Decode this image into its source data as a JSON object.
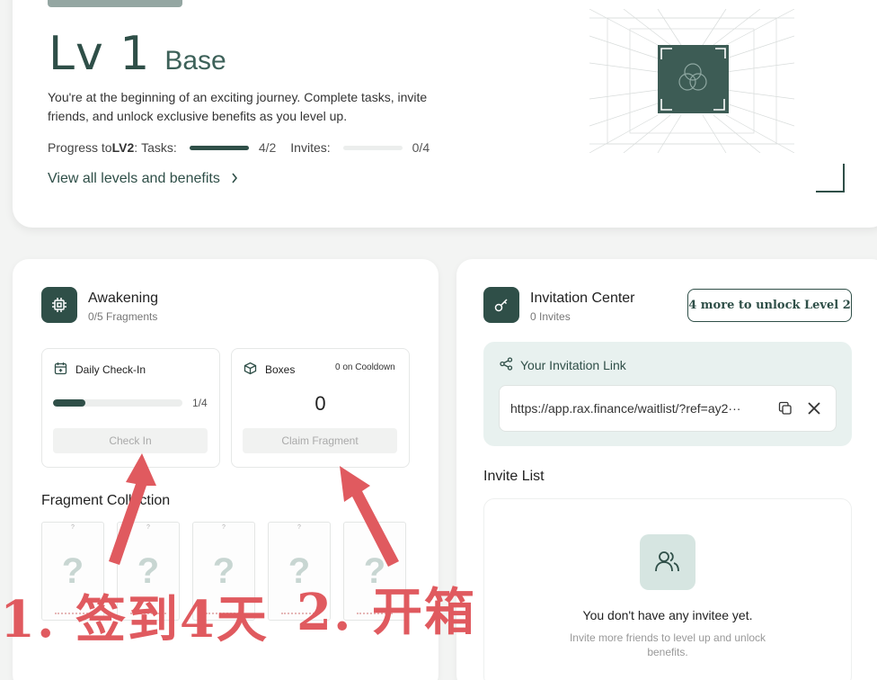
{
  "level": {
    "number": "Lv 1",
    "name": "Base",
    "description": "You're at the beginning of an exciting journey. Complete tasks, invite friends, and unlock exclusive benefits as you level up.",
    "progress_prefix": "Progress to ",
    "progress_target": "LV2",
    "progress_suffix": ":",
    "tasks_label": "Tasks:",
    "tasks_value": "4/2",
    "tasks_fraction": 1.0,
    "invites_label": "Invites:",
    "invites_value": "0/4",
    "invites_fraction": 0.0,
    "view_all_label": "View all levels and benefits"
  },
  "awakening": {
    "title": "Awakening",
    "subtitle": "0/5 Fragments",
    "checkin": {
      "title": "Daily Check-In",
      "count": "1/4",
      "fraction": 0.25,
      "button": "Check In"
    },
    "boxes": {
      "title": "Boxes",
      "cooldown": "0 on Cooldown",
      "count": "0",
      "button": "Claim Fragment"
    },
    "fragment_title": "Fragment Collection",
    "fragments": [
      "?",
      "?",
      "?",
      "?",
      "?"
    ]
  },
  "invitation": {
    "title": "Invitation Center",
    "subtitle": "0 Invites",
    "unlock_button": "4 more to unlock Level 2",
    "link_label": "Your Invitation Link",
    "link_url": "https://app.rax.finance/waitlist/?ref=ay2···",
    "list_title": "Invite List",
    "empty_title": "You don't have any invitee yet.",
    "empty_sub": "Invite more friends to level up and unlock benefits."
  },
  "annotations": {
    "step1": "1. 签到4天",
    "step2": "2. 开箱"
  },
  "colors": {
    "brand": "#2f4f48",
    "annotation": "#e05a5f",
    "panel": "#e8f1ef"
  }
}
